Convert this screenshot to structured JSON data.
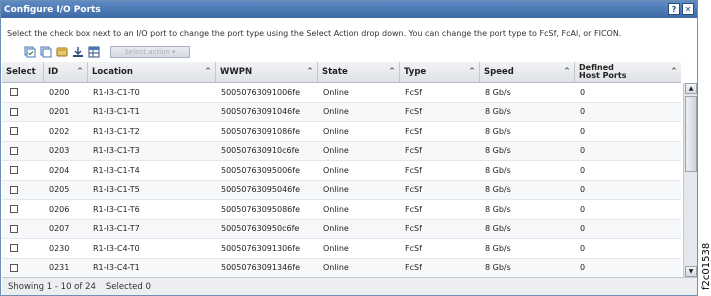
{
  "dialog": {
    "title": "Configure I/O Ports",
    "help_label": "?",
    "close_label": "✕"
  },
  "instructions": "Select the check box next to an I/O port to change the port type using the Select Action drop down. You can change the port type to FcSf, FcAl, or FICON.",
  "toolbar": {
    "icons": [
      "select-all-icon",
      "deselect-all-icon",
      "filter-icon",
      "export-icon",
      "configure-columns-icon"
    ],
    "select_action_label": "Select action ▾"
  },
  "table": {
    "columns": [
      "Select",
      "ID",
      "Location",
      "WWPN",
      "State",
      "Type",
      "Speed",
      "Defined Host Ports"
    ],
    "sort_indicator": "^",
    "rows": [
      {
        "id": "0200",
        "location": "R1-I3-C1-T0",
        "wwpn": "50050763091006fe",
        "state": "Online",
        "type": "FcSf",
        "speed": "8 Gb/s",
        "host_ports": "0"
      },
      {
        "id": "0201",
        "location": "R1-I3-C1-T1",
        "wwpn": "50050763091046fe",
        "state": "Online",
        "type": "FcSf",
        "speed": "8 Gb/s",
        "host_ports": "0"
      },
      {
        "id": "0202",
        "location": "R1-I3-C1-T2",
        "wwpn": "50050763091086fe",
        "state": "Online",
        "type": "FcSf",
        "speed": "8 Gb/s",
        "host_ports": "0"
      },
      {
        "id": "0203",
        "location": "R1-I3-C1-T3",
        "wwpn": "500507630910c6fe",
        "state": "Online",
        "type": "FcSf",
        "speed": "8 Gb/s",
        "host_ports": "0"
      },
      {
        "id": "0204",
        "location": "R1-I3-C1-T4",
        "wwpn": "50050763095006fe",
        "state": "Online",
        "type": "FcSf",
        "speed": "8 Gb/s",
        "host_ports": "0"
      },
      {
        "id": "0205",
        "location": "R1-I3-C1-T5",
        "wwpn": "50050763095046fe",
        "state": "Online",
        "type": "FcSf",
        "speed": "8 Gb/s",
        "host_ports": "0"
      },
      {
        "id": "0206",
        "location": "R1-I3-C1-T6",
        "wwpn": "50050763095086fe",
        "state": "Online",
        "type": "FcSf",
        "speed": "8 Gb/s",
        "host_ports": "0"
      },
      {
        "id": "0207",
        "location": "R1-I3-C1-T7",
        "wwpn": "500507630950c6fe",
        "state": "Online",
        "type": "FcSf",
        "speed": "8 Gb/s",
        "host_ports": "0"
      },
      {
        "id": "0230",
        "location": "R1-I3-C4-T0",
        "wwpn": "50050763091306fe",
        "state": "Online",
        "type": "FcSf",
        "speed": "8 Gb/s",
        "host_ports": "0"
      },
      {
        "id": "0231",
        "location": "R1-I3-C4-T1",
        "wwpn": "50050763091346fe",
        "state": "Online",
        "type": "FcSf",
        "speed": "8 Gb/s",
        "host_ports": "0"
      }
    ]
  },
  "footer": {
    "showing": "Showing 1 - 10 of 24",
    "selected": "Selected 0"
  },
  "figure_id": "f2c01538",
  "colors": {
    "titlebar": "#4a78b5",
    "header_bg": "#e6e8eb",
    "border": "#c4c8ce"
  }
}
